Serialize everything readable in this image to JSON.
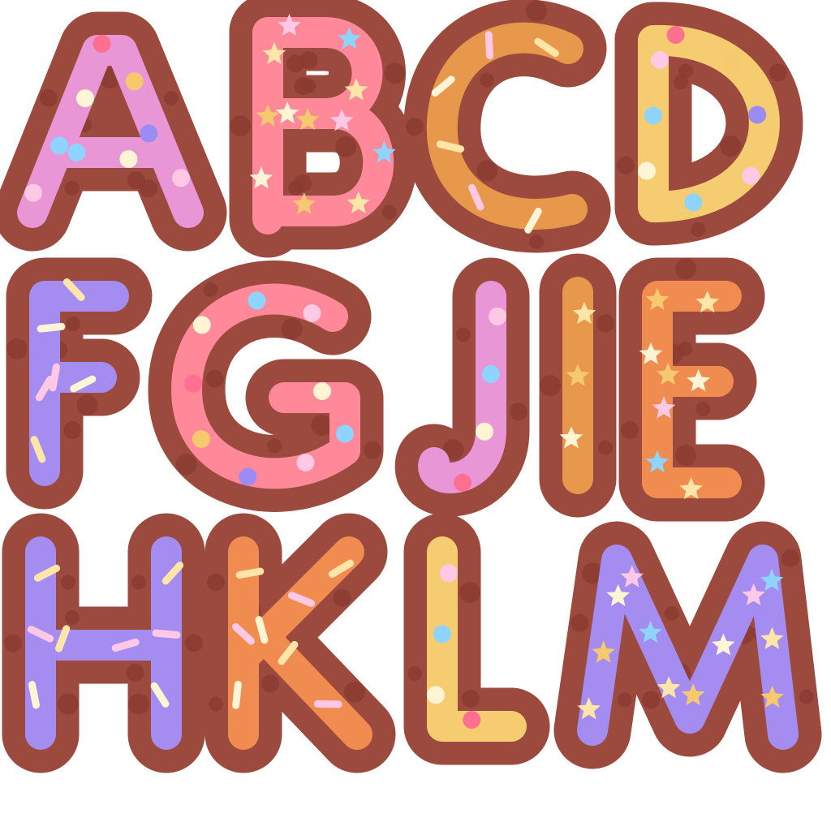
{
  "letters": [
    "A",
    "B",
    "C",
    "D",
    "F",
    "G",
    "J",
    "I",
    "E",
    "H",
    "K",
    "L",
    "M"
  ],
  "colors": {
    "cookie": "#9c4a3e",
    "cookie_dot": "#8a3a30",
    "pink": "#e896d6",
    "rose": "#ff8899",
    "caramel": "#e8984a",
    "butter": "#f5cc70",
    "lavender": "#a48cf0",
    "orange": "#f08c50",
    "sprinkle_blue": "#8ed4ff",
    "sprinkle_pink": "#ffc8e4",
    "sprinkle_yellow": "#ffe6a8",
    "sprinkle_cream": "#fff4d4",
    "sprinkle_violet": "#9a8cf4",
    "sprinkle_coral": "#ff6f8f",
    "sprinkle_gold": "#f7c96e"
  },
  "glyphs": [
    {
      "char": "A",
      "icing": "pink",
      "sprinkle": "dots",
      "paths": [
        "M40 262 L120 62 L150 62 L232 262",
        "M72 188 L200 188"
      ]
    },
    {
      "char": "B",
      "icing": "rose",
      "sprinkle": "stars",
      "paths": [
        "M330 40 L330 270",
        "M330 40 L400 40 C470 40 470 140 400 140 L330 140",
        "M330 140 L410 140 C485 140 485 260 410 260 L330 260"
      ]
    },
    {
      "char": "C",
      "icing": "caramel",
      "sprinkle": "rods",
      "paths": [
        "M700 60 C630 25 550 60 545 150 C540 240 620 280 705 258"
      ]
    },
    {
      "char": "D",
      "icing": "butter",
      "sprinkle": "dots",
      "paths": [
        "M805 50 L805 255",
        "M805 50 C985 45 990 255 805 255"
      ]
    },
    {
      "char": "F",
      "icing": "lavender",
      "sprinkle": "rods",
      "paths": [
        "M55 580 L55 365 L140 365",
        "M55 465 L125 465"
      ]
    },
    {
      "char": "G",
      "icing": "rose",
      "sprinkle": "dots",
      "paths": [
        "M410 390 C330 340 230 380 230 480 C230 585 350 610 425 555 L425 490 L350 490"
      ]
    },
    {
      "char": "J",
      "icing": "pink",
      "sprinkle": "dots",
      "paths": [
        "M605 365 L605 530 C605 600 525 600 535 570"
      ]
    },
    {
      "char": "I",
      "icing": "caramel",
      "sprinkle": "stars",
      "paths": [
        "M712 360 L712 590"
      ]
    },
    {
      "char": "E",
      "icing": "orange",
      "sprinkle": "stars",
      "paths": [
        "M895 365 L810 365 L810 595 L895 595",
        "M810 470 L885 470"
      ]
    },
    {
      "char": "H",
      "icing": "lavender",
      "sprinkle": "rods",
      "paths": [
        "M50 680 L50 905",
        "M205 680 L205 905",
        "M50 795 L205 795"
      ]
    },
    {
      "char": "K",
      "icing": "orange",
      "sprinkle": "rods",
      "paths": [
        "M300 680 L300 905",
        "M430 680 L300 810",
        "M330 790 L440 905"
      ]
    },
    {
      "char": "L",
      "icing": "butter",
      "sprinkle": "dots",
      "paths": [
        "M545 680 L545 895 L630 895"
      ]
    },
    {
      "char": "M",
      "icing": "lavender",
      "sprinkle": "stars",
      "paths": [
        "M730 900 L760 690 L850 885 L940 690 L965 905"
      ]
    }
  ]
}
